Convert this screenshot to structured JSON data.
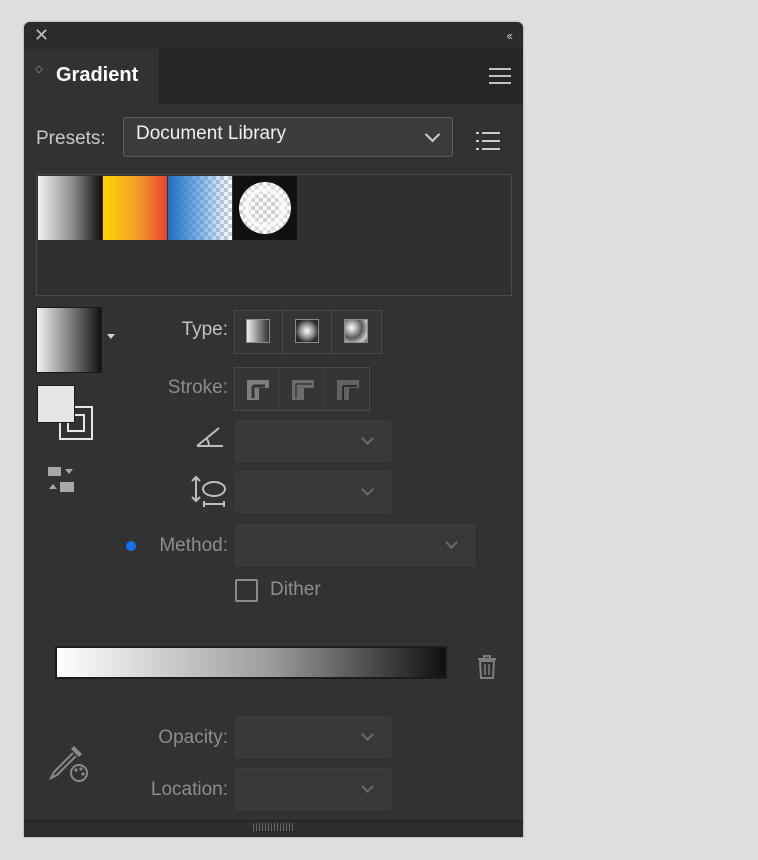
{
  "panel": {
    "tab_title": "Gradient",
    "close_glyph": "✕",
    "collapse_glyph": "‹‹"
  },
  "presets": {
    "label": "Presets:",
    "selected": "Document Library"
  },
  "swatches": [
    {
      "name": "white-to-black-linear"
    },
    {
      "name": "yellow-to-red-linear"
    },
    {
      "name": "blue-to-transparent-linear"
    },
    {
      "name": "white-radial-fade"
    }
  ],
  "type_row": {
    "label": "Type:"
  },
  "stroke_row": {
    "label": "Stroke:"
  },
  "method_row": {
    "label": "Method:"
  },
  "dither": {
    "label": "Dither",
    "checked": false
  },
  "opacity_row": {
    "label": "Opacity:"
  },
  "location_row": {
    "label": "Location:"
  },
  "colors": {
    "panel_bg": "#323232",
    "accent_dot": "#1473e6"
  }
}
